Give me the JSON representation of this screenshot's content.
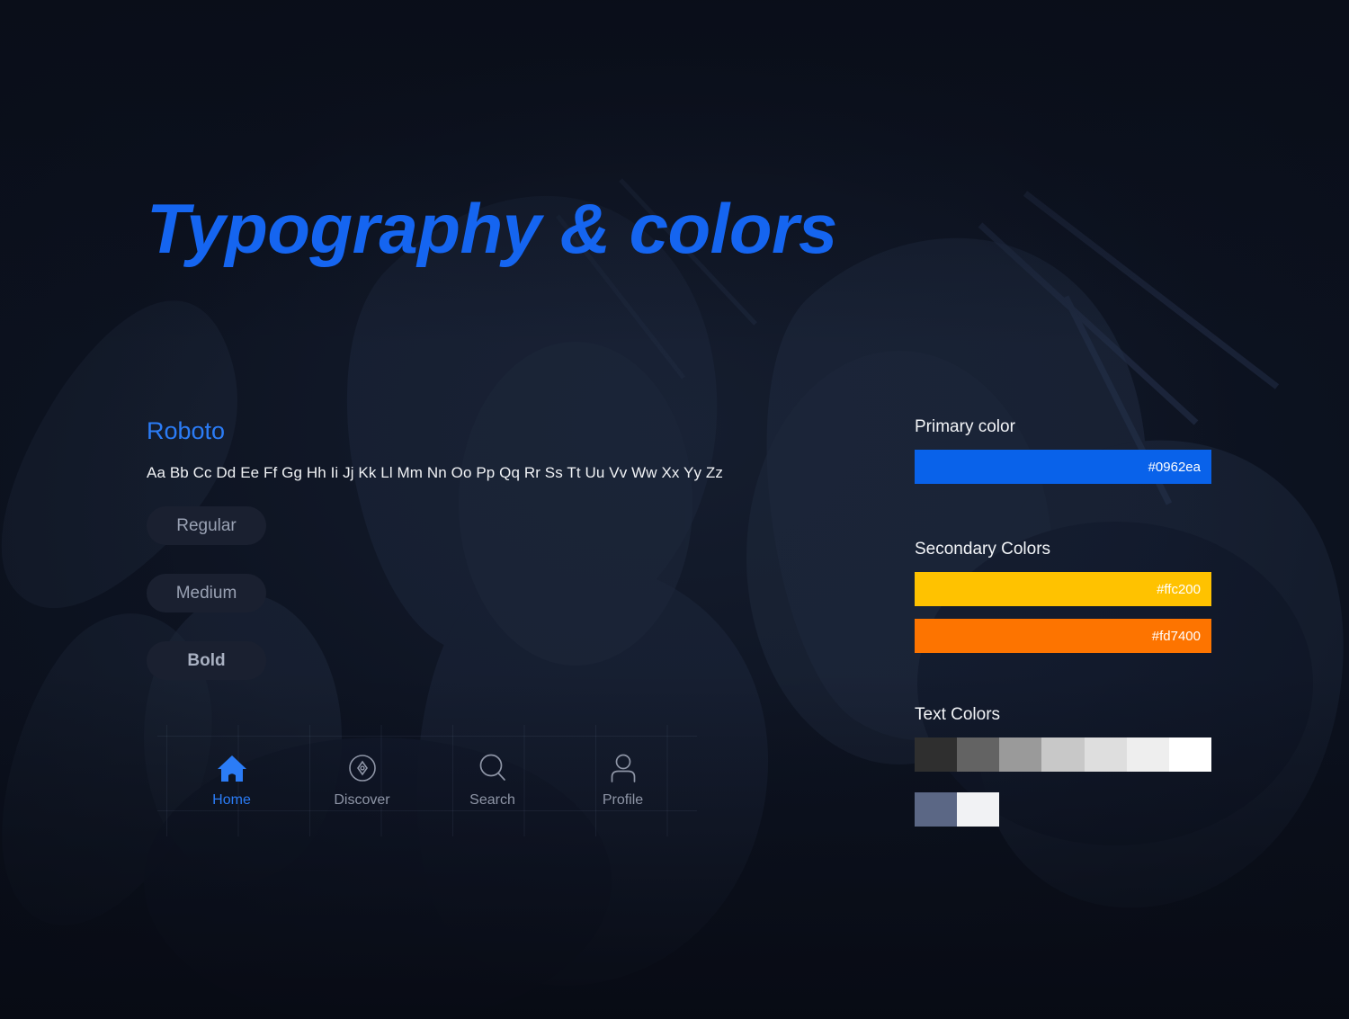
{
  "page": {
    "title": "Typography & colors",
    "background_color": "#0d1321",
    "accent_color": "#1565f0"
  },
  "typography": {
    "font_name": "Roboto",
    "font_name_color": "#2b7cf6",
    "alphabet": "Aa Bb Cc Dd Ee Ff Gg Hh Ii Jj Kk Ll Mm Nn Oo Pp Qq Rr Ss Tt Uu Vv Ww Xx Yy Zz",
    "weights": [
      {
        "label": "Regular"
      },
      {
        "label": "Medium"
      },
      {
        "label": "Bold"
      }
    ]
  },
  "nav": {
    "items": [
      {
        "label": "Home",
        "icon": "home-icon",
        "active": true
      },
      {
        "label": "Discover",
        "icon": "compass-icon",
        "active": false
      },
      {
        "label": "Search",
        "icon": "search-icon",
        "active": false
      },
      {
        "label": "Profile",
        "icon": "person-icon",
        "active": false
      }
    ],
    "active_color": "#2b7cf6",
    "inactive_color": "#8e95a6"
  },
  "colors": {
    "primary": {
      "title": "Primary color",
      "swatches": [
        {
          "hex": "#0962ea",
          "label": "#0962ea"
        }
      ]
    },
    "secondary": {
      "title": "Secondary Colors",
      "swatches": [
        {
          "hex": "#ffc200",
          "label": "#ffc200"
        },
        {
          "hex": "#fd7400",
          "label": "#fd7400"
        }
      ]
    },
    "text": {
      "title": "Text Colors",
      "row1": [
        "#2f2f2f",
        "#636363",
        "#9a9a9a",
        "#c8c8c8",
        "#dedede",
        "#eeeeee",
        "#ffffff"
      ],
      "row2": [
        "#5b6785",
        "#f1f2f4"
      ]
    }
  }
}
